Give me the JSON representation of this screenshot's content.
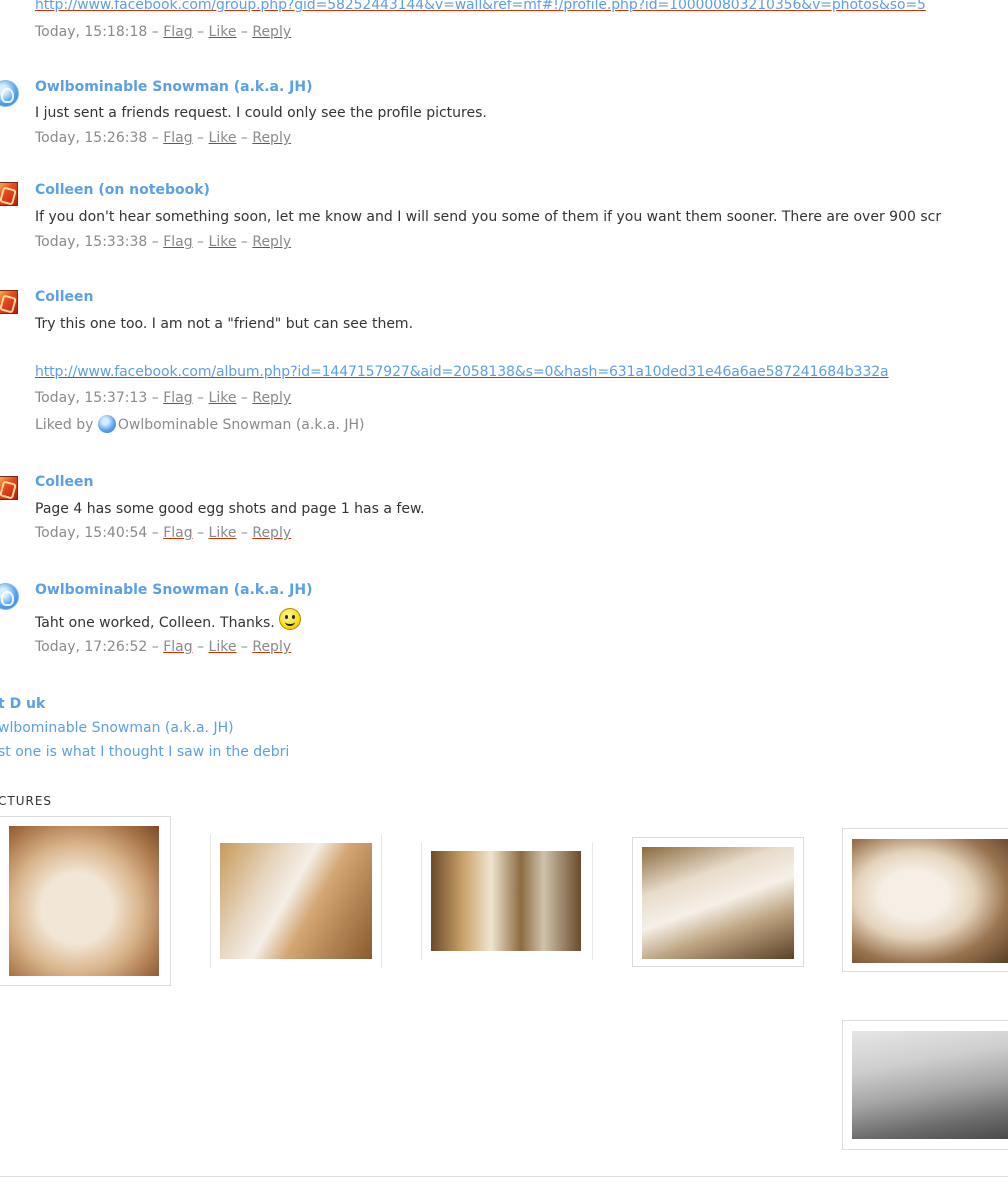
{
  "comments": [
    {
      "id": "c0",
      "link": "http://www.facebook.com/group.php?gid=58252443144&v=wall&ref=mf#!/profile.php?id=100000803210356&v=photos&so=5",
      "timestamp": "Today, 15:18:18",
      "actions": {
        "flag": "Flag",
        "like": "Like",
        "reply": "Reply"
      }
    },
    {
      "id": "c1",
      "author": "Owlbominable Snowman (a.k.a. JH)",
      "text": "I just sent a friends request.  I could only see the profile pictures.",
      "timestamp": "Today, 15:26:38",
      "actions": {
        "flag": "Flag",
        "like": "Like",
        "reply": "Reply"
      }
    },
    {
      "id": "c2",
      "author": "Colleen (on notebook)",
      "text": "If you don't hear something soon, let me know and I will send you some of them if you want them sooner. There are over 900 scr",
      "timestamp": "Today, 15:33:38",
      "actions": {
        "flag": "Flag",
        "like": "Like",
        "reply": "Reply"
      }
    },
    {
      "id": "c3",
      "author": "Colleen",
      "text": "Try this one too. I am not a \"friend\" but can see them.",
      "link": "http://www.facebook.com/album.php?id=1447157927&aid=2058138&s=0&hash=631a10ded31e46a6ae587241684b332a",
      "timestamp": "Today, 15:37:13",
      "actions": {
        "flag": "Flag",
        "like": "Like",
        "reply": "Reply"
      },
      "liked_by_prefix": "Liked by",
      "liked_by_name": "Owlbominable Snowman (a.k.a. JH)"
    },
    {
      "id": "c4",
      "author": "Colleen",
      "text": "Page 4 has some good egg shots and page 1 has a few.",
      "timestamp": "Today, 15:40:54",
      "actions": {
        "flag": "Flag",
        "like": "Like",
        "reply": "Reply"
      }
    },
    {
      "id": "c5",
      "author": "Owlbominable Snowman (a.k.a. JH)",
      "text": "Taht one worked, Colleen.  Thanks.",
      "timestamp": "Today, 17:26:52",
      "actions": {
        "flag": "Flag",
        "like": "Like",
        "reply": "Reply"
      }
    }
  ],
  "post_footer": {
    "title": "t D uk",
    "author": "wlbominable Snowman (a.k.a. JH)",
    "summary": "st one is what I thought I saw in the debri"
  },
  "pictures": {
    "heading": "CTURES"
  },
  "colors": {
    "link": "#5b9fe8",
    "underline": "#cc3300",
    "meta": "#8a8a8a"
  },
  "icons": {
    "avatar_blue": "owl-avatar-icon",
    "avatar_red": "colleen-avatar-icon",
    "smiley": "smiley-icon"
  }
}
